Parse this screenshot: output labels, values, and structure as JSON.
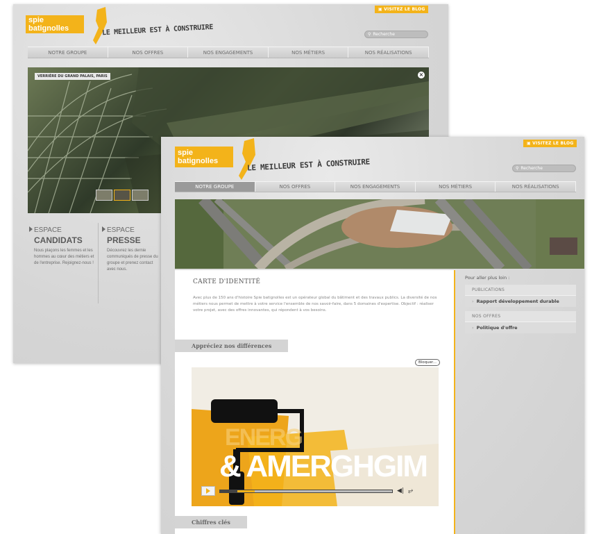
{
  "back_window": {
    "blog_label": "VISITEZ LE BLOG",
    "logo": "spie batignolles",
    "tagline": "LE MEILLEUR EST À CONSTRUIRE",
    "search_placeholder": "Recherche",
    "nav": [
      "NOTRE GROUPE",
      "NOS OFFRES",
      "NOS ENGAGEMENTS",
      "NOS MÉTIERS",
      "NOS RÉALISATIONS"
    ],
    "hero_caption": "VERRIÈRE DU GRAND PALAIS, PARIS",
    "espace_candidats": {
      "title_small": "ESPACE",
      "title_big": "CANDIDATS",
      "body": "Nous plaçons les femmes et les hommes au cœur des métiers et de l'entreprise. Rejoignez-nous !"
    },
    "espace_presse": {
      "title_small": "ESPACE",
      "title_big": "PRESSE",
      "body": "Découvrez les dernie communiqués de presse du groupe et prenez contact avec nous."
    }
  },
  "front_window": {
    "blog_label": "VISITEZ LE BLOG",
    "logo": "spie batignolles",
    "tagline": "LE MEILLEUR EST À CONSTRUIRE",
    "search_placeholder": "Recherche",
    "nav": [
      "NOTRE GROUPE",
      "NOS OFFRES",
      "NOS ENGAGEMENTS",
      "NOS MÉTIERS",
      "NOS RÉALISATIONS"
    ],
    "active_nav": "NOTRE GROUPE",
    "content": {
      "heading": "CARTE D'IDENTITÉ",
      "intro": "Avec plus de 150 ans d'histoire Spie batignolles est un opérateur global du bâtiment et des travaux publics. La diversité de nos métiers nous permet de mettre à votre service l'ensemble de nos savoir-faire, dans 5 domaines d'expertise. Objectif : réaliser votre projet, avec des offres innovantes, qui répondent à vos besoins.",
      "section1": "Appréciez nos différences",
      "bloquer": "Bloquer...",
      "video_text_1": "ENERG",
      "video_text_2": "& AMERGHGIM",
      "video_progress": 0.2,
      "section2": "Chiffres clés"
    },
    "sidebar": {
      "title": "Pour aller plus loin :",
      "box1_label": "PUBLICATIONS",
      "box1_link": "Rapport développement durable",
      "box2_label": "NOS OFFRES",
      "box2_link": "Politique d'offre"
    }
  }
}
